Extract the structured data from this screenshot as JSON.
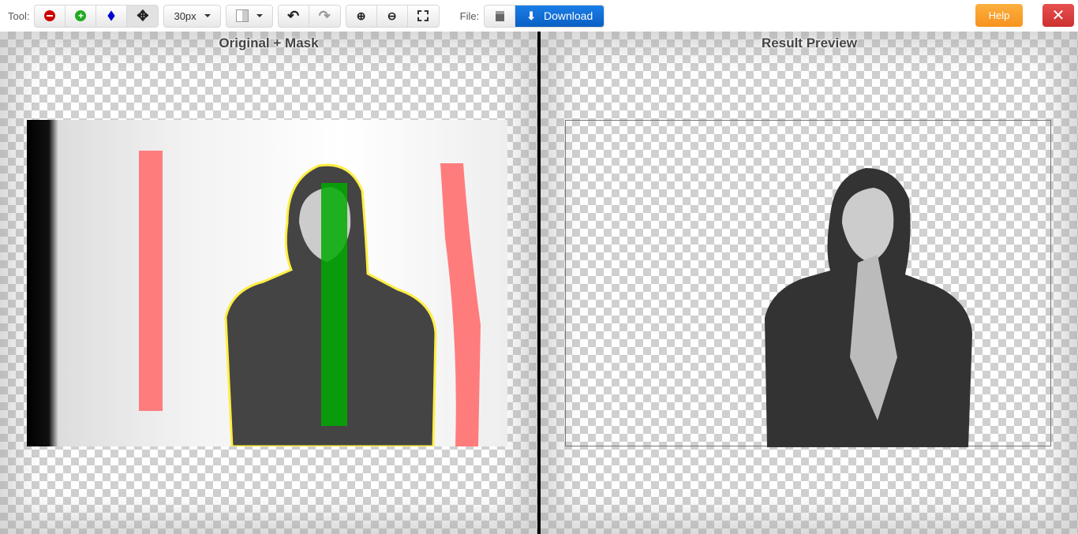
{
  "toolbar": {
    "tool_label": "Tool:",
    "tools": [
      {
        "name": "remove",
        "icon": "minus-circle-icon",
        "color": "#cc0000"
      },
      {
        "name": "keep",
        "icon": "plus-circle-icon",
        "color": "#22aa22"
      },
      {
        "name": "eraser",
        "icon": "eraser-icon",
        "color": "#0000cc"
      },
      {
        "name": "pan",
        "icon": "move-icon",
        "active": true
      }
    ],
    "brush_size": "30px",
    "background_icon": "checkerboard-icon",
    "file_label": "File:",
    "download_label": "Download",
    "help_label": "Help",
    "close_label": "✕"
  },
  "left_panel": {
    "title": "Original + Mask",
    "keep_color": "#00aa00",
    "remove_color": "#ff7070",
    "outline_color": "#ffee44"
  },
  "right_panel": {
    "title": "Result Preview"
  }
}
